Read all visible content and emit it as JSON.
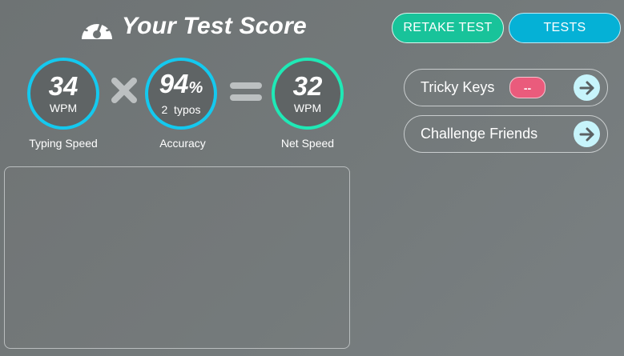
{
  "header": {
    "title": "Your Test Score",
    "icon": "speedometer-icon"
  },
  "buttons": {
    "retake_label": "RETAKE TEST",
    "tests_label": "TESTS"
  },
  "scores": {
    "typing_speed": {
      "value": "34",
      "unit": "WPM",
      "caption": "Typing Speed"
    },
    "accuracy": {
      "value": "94",
      "suffix": "%",
      "detail": "2  typos",
      "caption": "Accuracy"
    },
    "net_speed": {
      "value": "32",
      "unit": "WPM",
      "caption": "Net Speed"
    }
  },
  "side": {
    "tricky_keys_label": "Tricky Keys",
    "tricky_keys_badge": "--",
    "challenge_label": "Challenge Friends"
  },
  "colors": {
    "retake": "#18c39a",
    "tests": "#05b1d6",
    "ring_blue": "#14c9ef",
    "ring_green": "#1fe9b6",
    "badge": "#ea5b7c",
    "arrow_bg": "#c7f4fb"
  }
}
